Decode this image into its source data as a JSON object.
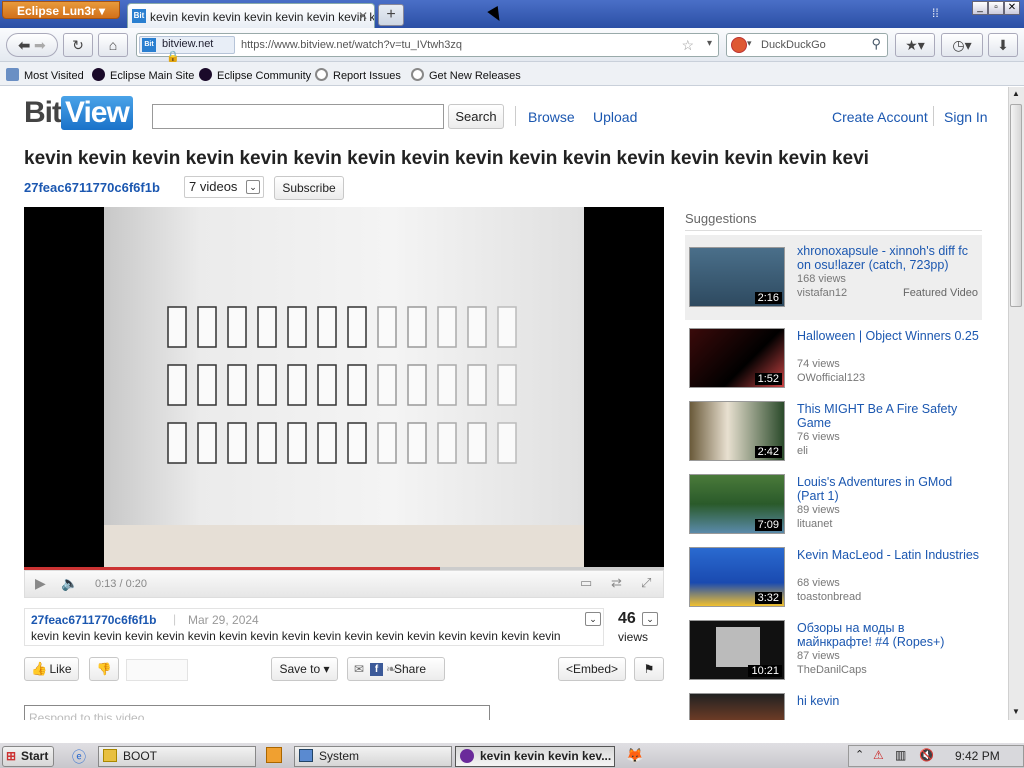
{
  "browser": {
    "app_menu": "Eclipse Lun3r",
    "tab_title": "kevin kevin kevin kevin kevin kevin kevin k",
    "tab_favicon": "Bit",
    "url_site": "bitview.net",
    "url": "https://www.bitview.net/watch?v=tu_IVtwh3zq",
    "search_placeholder": "DuckDuckGo",
    "bookmarks": [
      "Most Visited",
      "Eclipse Main Site",
      "Eclipse Community",
      "Report Issues",
      "Get New Releases"
    ]
  },
  "site": {
    "logo_bit": "Bit",
    "logo_view": "View",
    "search_value": "",
    "search_button": "Search",
    "nav": [
      "Browse",
      "Upload"
    ],
    "create_account": "Create Account",
    "sign_in": "Sign In"
  },
  "video": {
    "title": "kevin kevin kevin kevin kevin kevin kevin kevin kevin kevin kevin kevin kevin kevin kevin kevi",
    "channel": "27feac6711770c6f6f1b",
    "videos_count": "7 videos",
    "subscribe": "Subscribe",
    "time": "0:13 / 0:20",
    "progress": 0.65,
    "uploader": "27feac6711770c6f6f1b",
    "date": "Mar 29, 2024",
    "description": "kevin kevin kevin kevin kevin kevin kevin kevin kevin kevin kevin kevin kevin kevin kevin kevin kevin",
    "views_count": "46",
    "views_label": "views",
    "like": "Like",
    "save_to": "Save to",
    "share": "Share",
    "embed": "<Embed>",
    "comment_placeholder": "Respond to this video"
  },
  "suggestions": {
    "heading": "Suggestions",
    "items": [
      {
        "title": "xhronoxapsule - xinnoh's diff fc on osu!lazer (catch, 723pp)",
        "views": "168 views",
        "user": "vistafan12",
        "duration": "2:16",
        "featured": "Featured Video"
      },
      {
        "title": "Halloween | Object Winners 0.25",
        "views": "74 views",
        "user": "OWofficial123",
        "duration": "1:52"
      },
      {
        "title": "This MIGHT Be A Fire Safety Game",
        "views": "76 views",
        "user": "eli",
        "duration": "2:42"
      },
      {
        "title": "Louis's Adventures in GMod (Part 1)",
        "views": "89 views",
        "user": "lituanet",
        "duration": "7:09"
      },
      {
        "title": "Kevin MacLeod - Latin Industries",
        "views": "68 views",
        "user": "toastonbread",
        "duration": "3:32"
      },
      {
        "title": "Обзоры на моды в майнкрафте! #4 (Ropes+)",
        "views": "87 views",
        "user": "TheDanilCaps",
        "duration": "10:21"
      },
      {
        "title": "hi kevin",
        "views": "",
        "user": "",
        "duration": ""
      }
    ]
  },
  "taskbar": {
    "start": "Start",
    "items": [
      "BOOT",
      "System",
      "kevin kevin kevin kev..."
    ],
    "clock": "9:42 PM"
  }
}
